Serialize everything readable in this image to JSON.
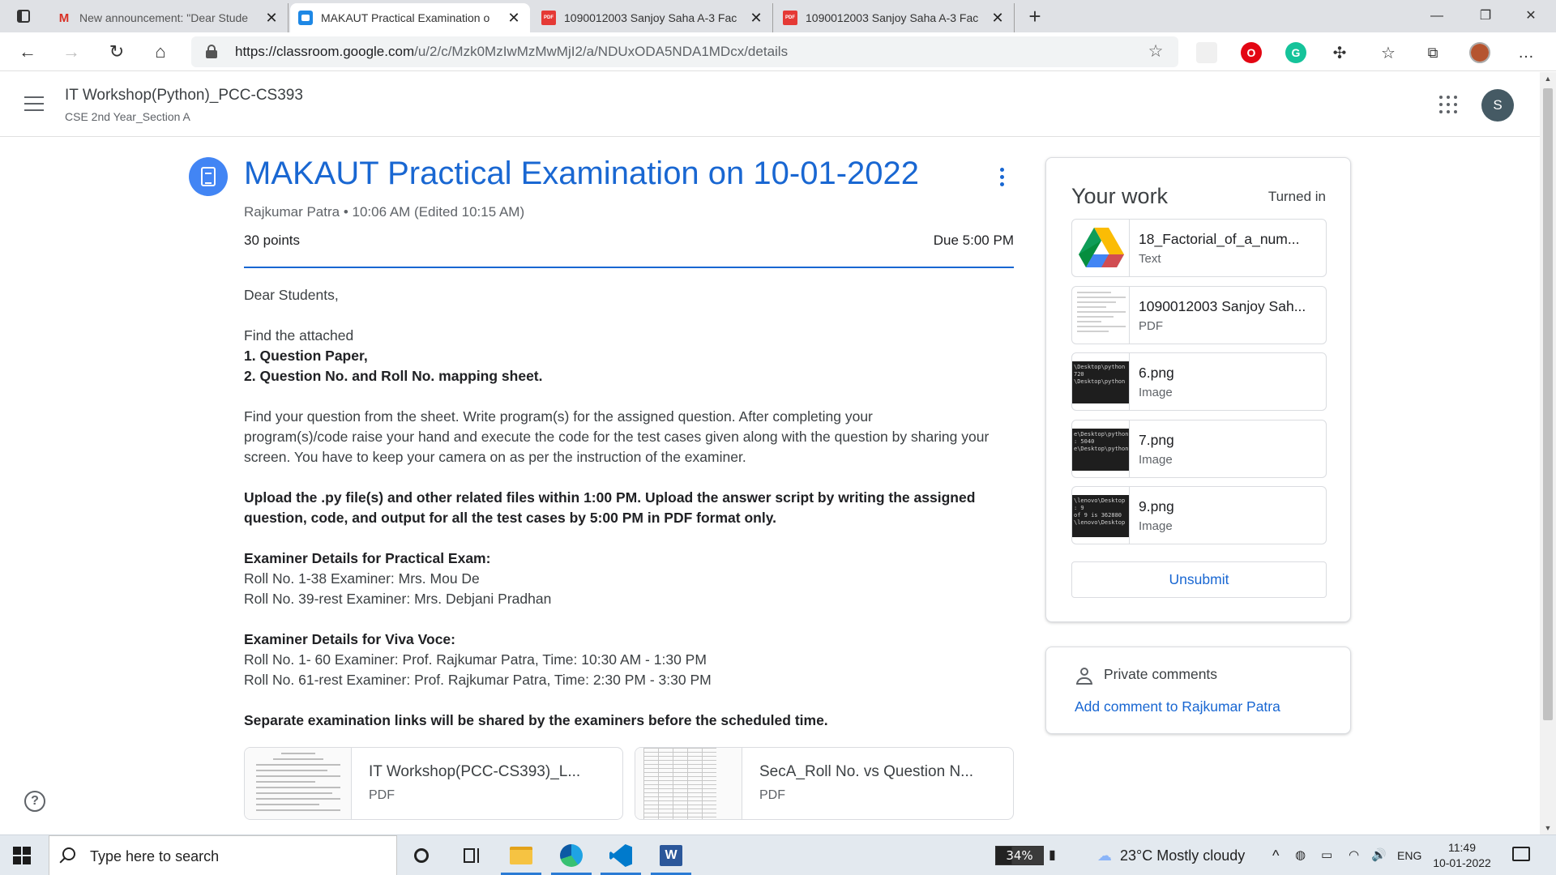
{
  "browser": {
    "tabs": [
      {
        "title": "New announcement: \"Dear Stude",
        "icon": "gmail-icon",
        "active": false
      },
      {
        "title": "MAKAUT Practical Examination o",
        "icon": "classroom-icon",
        "active": true
      },
      {
        "title": "1090012003 Sanjoy Saha A-3 Fac",
        "icon": "pdf-icon",
        "active": false
      },
      {
        "title": "1090012003 Sanjoy Saha A-3 Fac",
        "icon": "pdf-icon",
        "active": false
      }
    ],
    "url_host": "https://classroom.google.com",
    "url_path": "/u/2/c/Mzk0MzIwMzMwMjI2/a/NDUxODA5NDA1MDcx/details",
    "profile_color": "#b5542f"
  },
  "header": {
    "class_title": "IT Workshop(Python)_PCC-CS393",
    "class_subtitle": "CSE 2nd Year_Section A",
    "avatar_letter": "S"
  },
  "assignment": {
    "title": "MAKAUT Practical Examination on 10-01-2022",
    "meta": "Rajkumar Patra • 10:06 AM (Edited 10:15 AM)",
    "points": "30 points",
    "due": "Due 5:00 PM",
    "body": [
      {
        "text": "Dear Students,",
        "bold": false
      },
      {
        "text": "Find the attached",
        "bold": false
      },
      {
        "text": "1. Question Paper,",
        "bold": true
      },
      {
        "text": "2. Question No. and Roll No. mapping sheet.",
        "bold": true
      },
      {
        "text": "Find your question from the sheet.  Write program(s) for the assigned question. After completing your",
        "bold": false
      },
      {
        "text": "program(s)/code raise your hand and execute the code for the test cases given along with the question by sharing your",
        "bold": false
      },
      {
        "text": "screen. You have to keep your camera on as per the instruction of the examiner.",
        "bold": false
      },
      {
        "text": "Upload the .py file(s) and other related files within 1:00 PM. Upload the answer script by writing the assigned",
        "bold": true
      },
      {
        "text": "question, code, and output for all the test cases by 5:00 PM in PDF format only.",
        "bold": true
      },
      {
        "text": "Examiner Details for Practical Exam:",
        "bold": true
      },
      {
        "text": "Roll No. 1-38  Examiner: Mrs. Mou De",
        "bold": false
      },
      {
        "text": "Roll No. 39-rest Examiner: Mrs. Debjani Pradhan",
        "bold": false
      },
      {
        "text": "Examiner Details for Viva Voce:",
        "bold": true
      },
      {
        "text": "Roll No. 1- 60  Examiner: Prof. Rajkumar Patra, Time: 10:30 AM - 1:30 PM",
        "bold": false
      },
      {
        "text": "Roll No. 61-rest Examiner: Prof. Rajkumar Patra, Time: 2:30 PM - 3:30 PM",
        "bold": false
      },
      {
        "text": "Separate examination links will be shared by the examiners before the scheduled time.",
        "bold": true
      }
    ],
    "attachments": [
      {
        "name": "IT Workshop(PCC-CS393)_L...",
        "type": "PDF"
      },
      {
        "name": "SecA_Roll No. vs Question N...",
        "type": "PDF"
      }
    ]
  },
  "your_work": {
    "title": "Your work",
    "status": "Turned in",
    "files": [
      {
        "name": "18_Factorial_of_a_num...",
        "type": "Text",
        "thumb": "google-drive-icon"
      },
      {
        "name": "1090012003 Sanjoy Sah...",
        "type": "PDF",
        "thumb": "pdf-preview"
      },
      {
        "name": "6.png",
        "type": "Image",
        "thumb": "terminal",
        "preview": [
          "\\Desktop\\python",
          "",
          "720",
          "\\Desktop\\python"
        ]
      },
      {
        "name": "7.png",
        "type": "Image",
        "thumb": "terminal",
        "preview": [
          "e\\Desktop\\python lab",
          "",
          ": 5040",
          "e\\Desktop\\python lab"
        ]
      },
      {
        "name": "9.png",
        "type": "Image",
        "thumb": "terminal",
        "preview": [
          "\\lenovo\\Desktop",
          ": 9",
          "of 9 is 362880",
          "\\lenovo\\Desktop"
        ]
      }
    ],
    "unsubmit_label": "Unsubmit"
  },
  "comments": {
    "label": "Private comments",
    "add_link": "Add comment to Rajkumar Patra"
  },
  "taskbar": {
    "search_placeholder": "Type here to search",
    "battery": "34%",
    "weather": "23°C  Mostly cloudy",
    "language": "ENG",
    "time": "11:49",
    "date": "10-01-2022"
  }
}
